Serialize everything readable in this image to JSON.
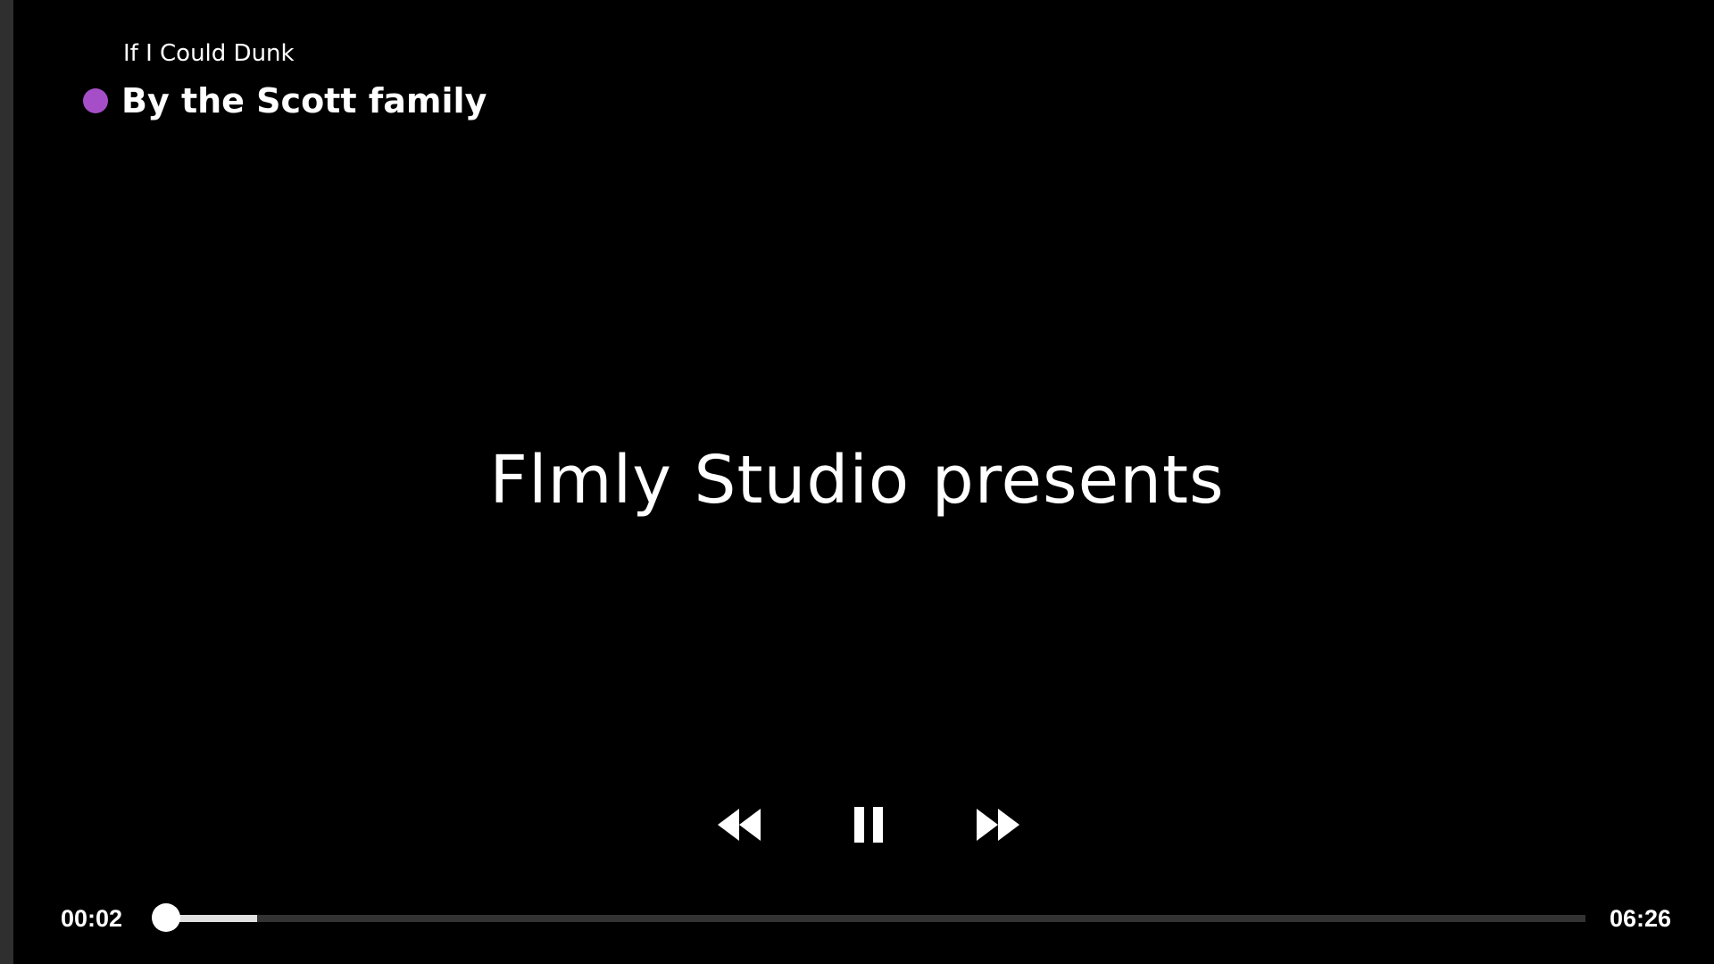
{
  "player": {
    "episode_title": "If I Could Dunk",
    "show_title": "By the Scott family",
    "status_dot_color": "#a64ec8",
    "frame_text": "Flmly Studio presents",
    "time_current": "00:02",
    "time_total": "06:26",
    "progress_fraction": 0.0052,
    "buffered_fraction": 0.069
  },
  "controls": {
    "rewind_icon": "rewind-icon",
    "pause_icon": "pause-icon",
    "forward_icon": "fast-forward-icon"
  }
}
